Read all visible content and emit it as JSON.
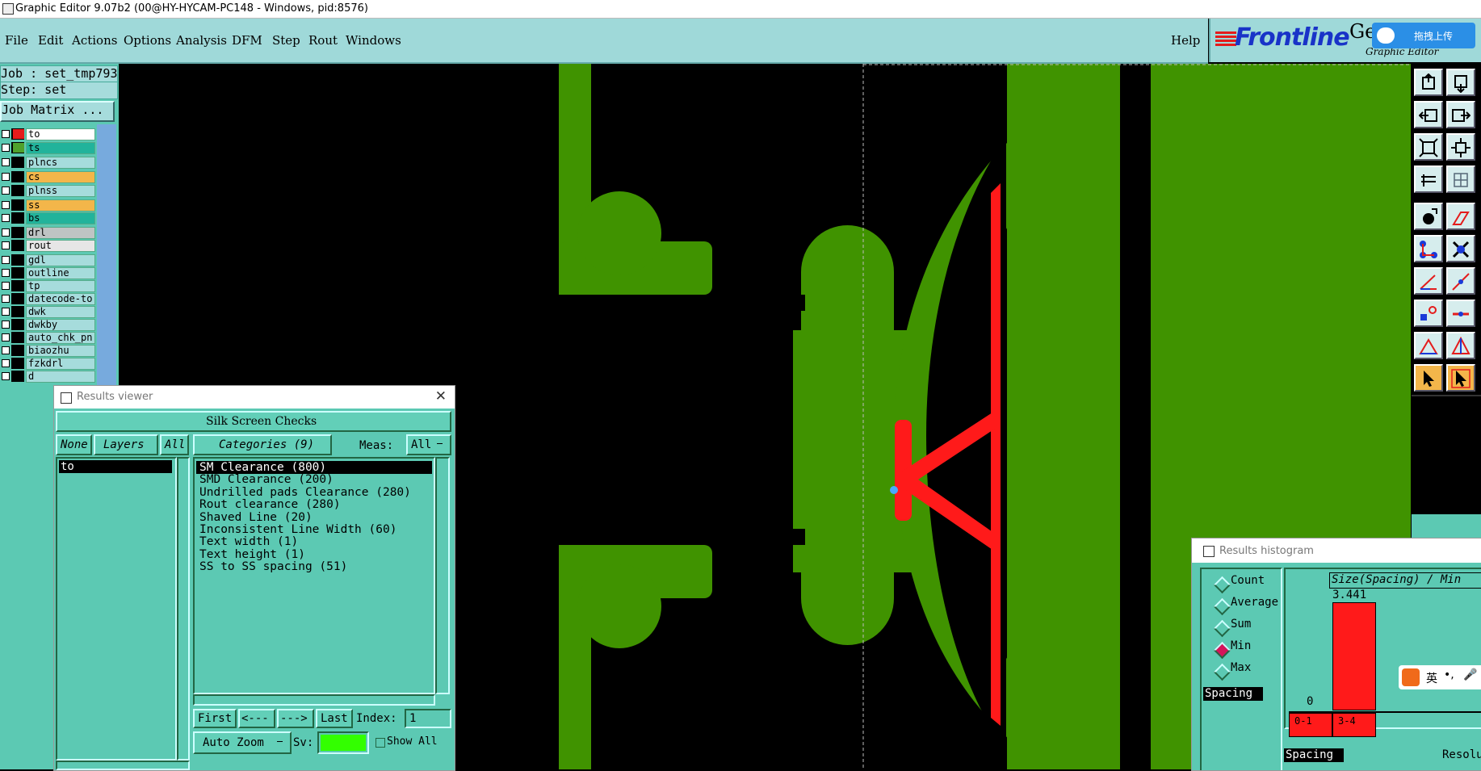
{
  "titlebar": {
    "title": "Graphic Editor 9.07b2 (00@HY-HYCAM-PC148 - Windows, pid:8576)"
  },
  "menu": {
    "items": [
      "File",
      "Edit",
      "Actions",
      "Options",
      "Analysis",
      "DFM",
      "Step",
      "Rout",
      "Windows"
    ],
    "help": "Help"
  },
  "logo": {
    "brand": "Frontline",
    "gen": "Gen",
    "sub": "Graphic Editor",
    "upload": "拖拽上传"
  },
  "job": {
    "job": "Job : set_tmp793",
    "step": "Step: set",
    "matrix": "Job Matrix ..."
  },
  "layers": [
    {
      "name": "to",
      "color": "#e41c1c",
      "bg": "#ffffff",
      "active": true
    },
    {
      "name": "ts",
      "color": "#4fa12d",
      "bg": "#22b39b"
    },
    {
      "name": "plncs",
      "color": "#000000",
      "bg": "#a6dcdc"
    },
    {
      "name": "cs",
      "color": "#000000",
      "bg": "#f3b64a"
    },
    {
      "name": "plnss",
      "color": "#000000",
      "bg": "#a6dcdc"
    },
    {
      "name": "ss",
      "color": "#000000",
      "bg": "#f3b64a"
    },
    {
      "name": "bs",
      "color": "#000000",
      "bg": "#22b39b"
    },
    {
      "name": "drl",
      "color": "#000000",
      "bg": "#bfc4c4"
    },
    {
      "name": "rout",
      "color": "#000000",
      "bg": "#e6e6e6"
    },
    {
      "name": "gdl",
      "color": "#000000",
      "bg": "#a6dcdc"
    },
    {
      "name": "outline",
      "color": "#000000",
      "bg": "#a6dcdc"
    },
    {
      "name": "tp",
      "color": "#000000",
      "bg": "#a6dcdc"
    },
    {
      "name": "datecode-to",
      "color": "#000000",
      "bg": "#a6dcdc"
    },
    {
      "name": "dwk",
      "color": "#000000",
      "bg": "#a6dcdc"
    },
    {
      "name": "dwkby",
      "color": "#000000",
      "bg": "#a6dcdc"
    },
    {
      "name": "auto_chk_pn",
      "color": "#000000",
      "bg": "#a6dcdc"
    },
    {
      "name": "biaozhu",
      "color": "#000000",
      "bg": "#a6dcdc"
    },
    {
      "name": "fzkdrl",
      "color": "#000000",
      "bg": "#a6dcdc"
    },
    {
      "name": "d",
      "color": "#000000",
      "bg": "#a6dcdc"
    }
  ],
  "results_viewer": {
    "title": "Results viewer",
    "header": "Silk Screen Checks",
    "none": "None",
    "layers": "Layers",
    "all": "All",
    "categories_label": "Categories (9)",
    "meas_label": "Meas:",
    "meas_value": "All",
    "layer_list": [
      "to"
    ],
    "categories": [
      "SM Clearance (800)",
      "SMD Clearance (200)",
      "Undrilled pads Clearance (280)",
      "Rout clearance (280)",
      "Shaved Line (20)",
      "Inconsistent Line Width (60)",
      "Text width (1)",
      "Text height (1)",
      "SS to SS spacing (51)"
    ],
    "selected_index": 0,
    "first": "First",
    "prev": "<---",
    "next": "--->",
    "last": "Last",
    "index_label": "Index:",
    "index_value": "1",
    "zoom": "Auto Zoom",
    "sv": "Sv:",
    "show_all": "Show All"
  },
  "histogram": {
    "title": "Results histogram",
    "options": [
      "Count",
      "Average",
      "Sum",
      "Min",
      "Max"
    ],
    "selected": "Min",
    "measure": "Spacing",
    "chart_title": "Size(Spacing) / Min",
    "bar_value": "3.441",
    "zero": "0",
    "bins": [
      "0-1",
      "3-4"
    ],
    "bottom_left": "Spacing",
    "bottom_right": "Resolu"
  },
  "ime": {
    "lang": "英"
  }
}
